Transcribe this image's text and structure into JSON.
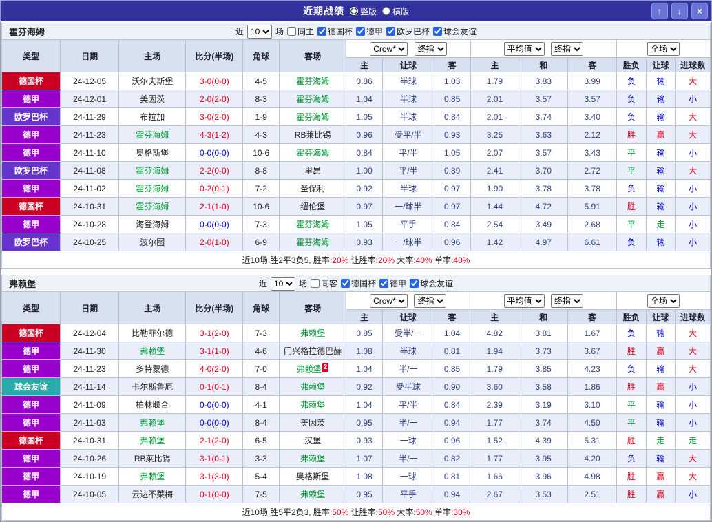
{
  "window": {
    "title": "近期战绩",
    "view_options": [
      {
        "label": "竖版",
        "selected": true
      },
      {
        "label": "横版",
        "selected": false
      }
    ],
    "buttons": {
      "up": "↑",
      "down": "↓",
      "close": "×"
    }
  },
  "colors": {
    "accent": "#3333a0",
    "odds_text": "#33417f",
    "team_highlight": "#009933",
    "score_red": "#e1001e",
    "score_blue": "#0000cc",
    "types": {
      "德国杯": "#cc0022",
      "德甲": "#9900cc",
      "欧罗巴杯": "#6633cc",
      "球会友谊": "#2aabab"
    },
    "results": {
      "胜": "#e1001e",
      "赢": "#e1001e",
      "大": "#e1001e",
      "负": "#0000cc",
      "输": "#0000cc",
      "小": "#0000cc",
      "平": "#009933",
      "走": "#009933"
    }
  },
  "columns": [
    "类型",
    "日期",
    "主场",
    "比分(半场)",
    "角球",
    "客场",
    "主",
    "让球",
    "客",
    "主",
    "和",
    "客",
    "胜负",
    "让球",
    "进球数"
  ],
  "odds_filters": {
    "group1": [
      "Crow*",
      "终指"
    ],
    "group2": [
      "平均值",
      "终指"
    ],
    "group3": [
      "全场"
    ]
  },
  "sections": [
    {
      "team": "霍芬海姆",
      "filter": {
        "near": "近",
        "count": "10",
        "games": "场",
        "same": {
          "label": "同主",
          "checked": false
        },
        "leagues": [
          {
            "label": "德国杯",
            "checked": true
          },
          {
            "label": "德甲",
            "checked": true
          },
          {
            "label": "欧罗巴杯",
            "checked": true
          },
          {
            "label": "球会友谊",
            "checked": true
          }
        ]
      },
      "rows": [
        {
          "type": "德国杯",
          "date": "24-12-05",
          "home": "沃尔夫斯堡",
          "home_hl": false,
          "score": "3-0(0-0)",
          "score_blue": false,
          "corner": "4-5",
          "away": "霍芬海姆",
          "away_hl": true,
          "away_badge": "",
          "odds": [
            "0.86",
            "半球",
            "1.03",
            "1.79",
            "3.83",
            "3.99"
          ],
          "res": [
            "负",
            "输",
            "大"
          ]
        },
        {
          "type": "德甲",
          "date": "24-12-01",
          "home": "美因茨",
          "home_hl": false,
          "score": "2-0(2-0)",
          "score_blue": false,
          "corner": "8-3",
          "away": "霍芬海姆",
          "away_hl": true,
          "away_badge": "",
          "odds": [
            "1.04",
            "半球",
            "0.85",
            "2.01",
            "3.57",
            "3.57"
          ],
          "res": [
            "负",
            "输",
            "小"
          ]
        },
        {
          "type": "欧罗巴杯",
          "date": "24-11-29",
          "home": "布拉加",
          "home_hl": false,
          "score": "3-0(2-0)",
          "score_blue": false,
          "corner": "1-9",
          "away": "霍芬海姆",
          "away_hl": true,
          "away_badge": "",
          "odds": [
            "1.05",
            "半球",
            "0.84",
            "2.01",
            "3.74",
            "3.40"
          ],
          "res": [
            "负",
            "输",
            "大"
          ]
        },
        {
          "type": "德甲",
          "date": "24-11-23",
          "home": "霍芬海姆",
          "home_hl": true,
          "score": "4-3(1-2)",
          "score_blue": false,
          "corner": "4-3",
          "away": "RB莱比锡",
          "away_hl": false,
          "away_badge": "",
          "odds": [
            "0.96",
            "受平/半",
            "0.93",
            "3.25",
            "3.63",
            "2.12"
          ],
          "res": [
            "胜",
            "赢",
            "大"
          ]
        },
        {
          "type": "德甲",
          "date": "24-11-10",
          "home": "奥格斯堡",
          "home_hl": false,
          "score": "0-0(0-0)",
          "score_blue": true,
          "corner": "10-6",
          "away": "霍芬海姆",
          "away_hl": true,
          "away_badge": "",
          "odds": [
            "0.84",
            "平/半",
            "1.05",
            "2.07",
            "3.57",
            "3.43"
          ],
          "res": [
            "平",
            "输",
            "小"
          ]
        },
        {
          "type": "欧罗巴杯",
          "date": "24-11-08",
          "home": "霍芬海姆",
          "home_hl": true,
          "score": "2-2(0-0)",
          "score_blue": false,
          "corner": "8-8",
          "away": "里昂",
          "away_hl": false,
          "away_badge": "",
          "odds": [
            "1.00",
            "平/半",
            "0.89",
            "2.41",
            "3.70",
            "2.72"
          ],
          "res": [
            "平",
            "输",
            "大"
          ]
        },
        {
          "type": "德甲",
          "date": "24-11-02",
          "home": "霍芬海姆",
          "home_hl": true,
          "score": "0-2(0-1)",
          "score_blue": false,
          "corner": "7-2",
          "away": "圣保利",
          "away_hl": false,
          "away_badge": "",
          "odds": [
            "0.92",
            "半球",
            "0.97",
            "1.90",
            "3.78",
            "3.78"
          ],
          "res": [
            "负",
            "输",
            "小"
          ]
        },
        {
          "type": "德国杯",
          "date": "24-10-31",
          "home": "霍芬海姆",
          "home_hl": true,
          "score": "2-1(1-0)",
          "score_blue": false,
          "corner": "10-6",
          "away": "纽伦堡",
          "away_hl": false,
          "away_badge": "",
          "odds": [
            "0.97",
            "一/球半",
            "0.97",
            "1.44",
            "4.72",
            "5.91"
          ],
          "res": [
            "胜",
            "输",
            "小"
          ]
        },
        {
          "type": "德甲",
          "date": "24-10-28",
          "home": "海登海姆",
          "home_hl": false,
          "score": "0-0(0-0)",
          "score_blue": true,
          "corner": "7-3",
          "away": "霍芬海姆",
          "away_hl": true,
          "away_badge": "",
          "odds": [
            "1.05",
            "平手",
            "0.84",
            "2.54",
            "3.49",
            "2.68"
          ],
          "res": [
            "平",
            "走",
            "小"
          ]
        },
        {
          "type": "欧罗巴杯",
          "date": "24-10-25",
          "home": "波尔图",
          "home_hl": false,
          "score": "2-0(1-0)",
          "score_blue": false,
          "corner": "6-9",
          "away": "霍芬海姆",
          "away_hl": true,
          "away_badge": "",
          "odds": [
            "0.93",
            "一/球半",
            "0.96",
            "1.42",
            "4.97",
            "6.61"
          ],
          "res": [
            "负",
            "输",
            "小"
          ]
        }
      ],
      "summary": [
        {
          "text": "近10场,胜2平3负5, 胜率:",
          "red": false
        },
        {
          "text": "20%",
          "red": true
        },
        {
          "text": " 让胜率:",
          "red": false
        },
        {
          "text": "20%",
          "red": true
        },
        {
          "text": " 大率:",
          "red": false
        },
        {
          "text": "40%",
          "red": true
        },
        {
          "text": " 单率:",
          "red": false
        },
        {
          "text": "40%",
          "red": true
        }
      ]
    },
    {
      "team": "弗赖堡",
      "filter": {
        "near": "近",
        "count": "10",
        "games": "场",
        "same": {
          "label": "同客",
          "checked": false
        },
        "leagues": [
          {
            "label": "德国杯",
            "checked": true
          },
          {
            "label": "德甲",
            "checked": true
          },
          {
            "label": "球会友谊",
            "checked": true
          }
        ]
      },
      "rows": [
        {
          "type": "德国杯",
          "date": "24-12-04",
          "home": "比勒菲尔德",
          "home_hl": false,
          "score": "3-1(2-0)",
          "score_blue": false,
          "corner": "7-3",
          "away": "弗赖堡",
          "away_hl": true,
          "away_badge": "",
          "odds": [
            "0.85",
            "受半/一",
            "1.04",
            "4.82",
            "3.81",
            "1.67"
          ],
          "res": [
            "负",
            "输",
            "大"
          ]
        },
        {
          "type": "德甲",
          "date": "24-11-30",
          "home": "弗赖堡",
          "home_hl": true,
          "score": "3-1(1-0)",
          "score_blue": false,
          "corner": "4-6",
          "away": "门兴格拉德巴赫",
          "away_hl": false,
          "away_badge": "",
          "odds": [
            "1.08",
            "半球",
            "0.81",
            "1.94",
            "3.73",
            "3.67"
          ],
          "res": [
            "胜",
            "赢",
            "大"
          ]
        },
        {
          "type": "德甲",
          "date": "24-11-23",
          "home": "多特蒙德",
          "home_hl": false,
          "score": "4-0(2-0)",
          "score_blue": false,
          "corner": "7-0",
          "away": "弗赖堡",
          "away_hl": true,
          "away_badge": "2",
          "odds": [
            "1.04",
            "半/一",
            "0.85",
            "1.79",
            "3.85",
            "4.23"
          ],
          "res": [
            "负",
            "输",
            "大"
          ]
        },
        {
          "type": "球会友谊",
          "date": "24-11-14",
          "home": "卡尔斯鲁厄",
          "home_hl": false,
          "score": "0-1(0-1)",
          "score_blue": false,
          "corner": "8-4",
          "away": "弗赖堡",
          "away_hl": true,
          "away_badge": "",
          "odds": [
            "0.92",
            "受半球",
            "0.90",
            "3.60",
            "3.58",
            "1.86"
          ],
          "res": [
            "胜",
            "赢",
            "小"
          ]
        },
        {
          "type": "德甲",
          "date": "24-11-09",
          "home": "柏林联合",
          "home_hl": false,
          "score": "0-0(0-0)",
          "score_blue": true,
          "corner": "4-1",
          "away": "弗赖堡",
          "away_hl": true,
          "away_badge": "",
          "odds": [
            "1.04",
            "平/半",
            "0.84",
            "2.39",
            "3.19",
            "3.10"
          ],
          "res": [
            "平",
            "输",
            "小"
          ]
        },
        {
          "type": "德甲",
          "date": "24-11-03",
          "home": "弗赖堡",
          "home_hl": true,
          "score": "0-0(0-0)",
          "score_blue": true,
          "corner": "8-4",
          "away": "美因茨",
          "away_hl": false,
          "away_badge": "",
          "odds": [
            "0.95",
            "半/一",
            "0.94",
            "1.77",
            "3.74",
            "4.50"
          ],
          "res": [
            "平",
            "输",
            "小"
          ]
        },
        {
          "type": "德国杯",
          "date": "24-10-31",
          "home": "弗赖堡",
          "home_hl": true,
          "score": "2-1(2-0)",
          "score_blue": false,
          "corner": "6-5",
          "away": "汉堡",
          "away_hl": false,
          "away_badge": "",
          "odds": [
            "0.93",
            "一球",
            "0.96",
            "1.52",
            "4.39",
            "5.31"
          ],
          "res": [
            "胜",
            "走",
            "走"
          ]
        },
        {
          "type": "德甲",
          "date": "24-10-26",
          "home": "RB莱比锡",
          "home_hl": false,
          "score": "3-1(0-1)",
          "score_blue": false,
          "corner": "3-3",
          "away": "弗赖堡",
          "away_hl": true,
          "away_badge": "",
          "odds": [
            "1.07",
            "半/一",
            "0.82",
            "1.77",
            "3.95",
            "4.20"
          ],
          "res": [
            "负",
            "输",
            "大"
          ]
        },
        {
          "type": "德甲",
          "date": "24-10-19",
          "home": "弗赖堡",
          "home_hl": true,
          "score": "3-1(3-0)",
          "score_blue": false,
          "corner": "5-4",
          "away": "奥格斯堡",
          "away_hl": false,
          "away_badge": "",
          "odds": [
            "1.08",
            "一球",
            "0.81",
            "1.66",
            "3.96",
            "4.98"
          ],
          "res": [
            "胜",
            "赢",
            "大"
          ]
        },
        {
          "type": "德甲",
          "date": "24-10-05",
          "home": "云达不莱梅",
          "home_hl": false,
          "score": "0-1(0-0)",
          "score_blue": false,
          "corner": "7-5",
          "away": "弗赖堡",
          "away_hl": true,
          "away_badge": "",
          "odds": [
            "0.95",
            "平手",
            "0.94",
            "2.67",
            "3.53",
            "2.51"
          ],
          "res": [
            "胜",
            "赢",
            "小"
          ]
        }
      ],
      "summary": [
        {
          "text": "近10场,胜5平2负3, 胜率:",
          "red": false
        },
        {
          "text": "50%",
          "red": true
        },
        {
          "text": " 让胜率:",
          "red": false
        },
        {
          "text": "50%",
          "red": true
        },
        {
          "text": " 大率:",
          "red": false
        },
        {
          "text": "50%",
          "red": true
        },
        {
          "text": " 单率:",
          "red": false
        },
        {
          "text": "30%",
          "red": true
        }
      ]
    }
  ]
}
